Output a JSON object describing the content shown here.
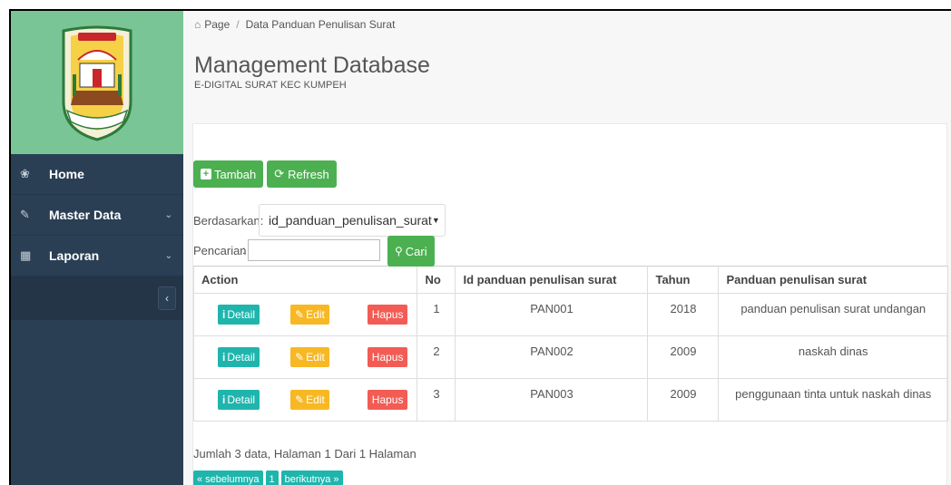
{
  "sidebar": {
    "logo_caption": "SAILUN SALIMBAI",
    "items": [
      {
        "label": "Home",
        "icon": "home-icon",
        "glyph": "❀",
        "has_children": false
      },
      {
        "label": "Master Data",
        "icon": "edit-icon",
        "glyph": "✎",
        "has_children": true
      },
      {
        "label": "Laporan",
        "icon": "calendar-icon",
        "glyph": "▦",
        "has_children": true
      }
    ],
    "collapse_glyph": "‹"
  },
  "breadcrumb": {
    "home": "Page",
    "current": "Data Panduan Penulisan Surat"
  },
  "header": {
    "title": "Management Database",
    "subtitle": "E-DIGITAL SURAT KEC KUMPEH"
  },
  "toolbar": {
    "add_label": "Tambah",
    "refresh_label": "Refresh"
  },
  "filter": {
    "label": "Berdasarkan:",
    "selected": "id_panduan_penulisan_surat"
  },
  "search": {
    "label": "Pencarian",
    "colon": ":",
    "value": "",
    "button_label": "Cari"
  },
  "table": {
    "headers": [
      "Action",
      "No",
      "Id panduan penulisan surat",
      "Tahun",
      "Panduan penulisan surat"
    ],
    "action_labels": {
      "detail": "Detail",
      "edit": "Edit",
      "delete": "Hapus"
    },
    "rows": [
      {
        "no": "1",
        "id": "PAN001",
        "tahun": "2018",
        "panduan": "panduan penulisan surat undangan"
      },
      {
        "no": "2",
        "id": "PAN002",
        "tahun": "2009",
        "panduan": "naskah dinas"
      },
      {
        "no": "3",
        "id": "PAN003",
        "tahun": "2009",
        "panduan": "penggunaan tinta untuk naskah dinas"
      }
    ]
  },
  "footer": {
    "info": "Jumlah 3 data, Halaman 1 Dari 1 Halaman",
    "prev": "« sebelumnya",
    "page": "1",
    "next": "berikutnya »"
  },
  "colors": {
    "sidebar": "#2a3f54",
    "logo_bg": "#7ac596",
    "green": "#4cb050",
    "info": "#1fb5ad",
    "warning": "#f7b824",
    "danger": "#f25c54"
  }
}
